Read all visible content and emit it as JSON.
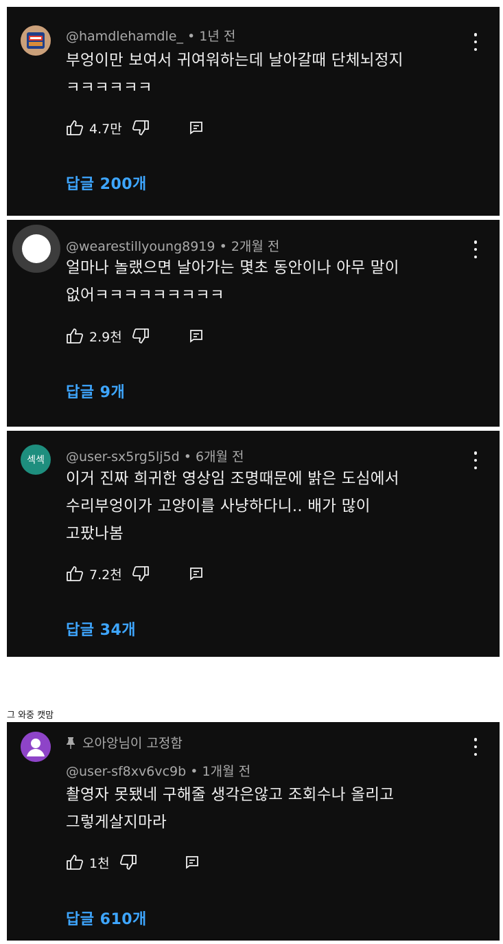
{
  "comments": [
    {
      "handle": "@hamdlehamdle_",
      "time": "1년 전",
      "lines": [
        "부엉이만 보여서 귀여워하는데 날아갈때 단체뇌정지",
        "ㅋㅋㅋㅋㅋㅋ"
      ],
      "likes": "4.7만",
      "replies": "답글 200개",
      "avatar_icon": "spam-can-avatar"
    },
    {
      "handle": "@wearestillyoung8919",
      "time": "2개월 전",
      "lines": [
        "얼마나 놀랬으면 날아가는 몇초 동안이나 아무 말이",
        "없어ㅋㅋㅋㅋㅋㅋㅋㅋㅋ"
      ],
      "likes": "2.9천",
      "replies": "답글 9개",
      "avatar_icon": "white-circle-avatar"
    },
    {
      "handle": "@user-sx5rg5lj5d",
      "time": "6개월 전",
      "lines": [
        "이거 진짜 희귀한 영상임 조명때문에 밝은 도심에서",
        "수리부엉이가 고양이를 사냥하다니.. 배가 많이",
        "고팠나봄"
      ],
      "likes": "7.2천",
      "replies": "답글 34개",
      "avatar_text": "섹섹",
      "avatar_color": "#1e8e7e"
    },
    {
      "pinned": "오아앙님이 고정함",
      "handle": "@user-sf8xv6vc9b",
      "time": "1개월 전",
      "lines": [
        "촬영자 못됐네 구해줄 생각은않고 조회수나 올리고",
        "그렇게살지마라"
      ],
      "likes": "1천",
      "replies": "답글 610개",
      "avatar_color": "#8e44c8"
    }
  ],
  "caption": "그 와중 캣맘",
  "separator": "•",
  "colors": {
    "card_bg": "#0f0f0f",
    "link": "#3ea6ff",
    "meta": "#aaaaaa",
    "text": "#f1f1f1"
  }
}
